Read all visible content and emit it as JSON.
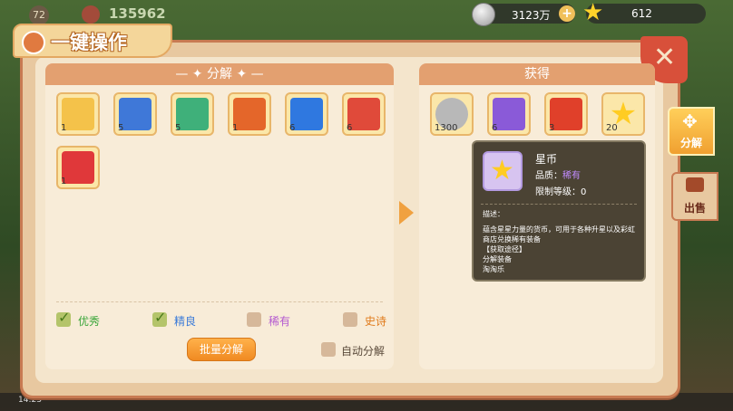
{
  "hud": {
    "level": "72",
    "score": "135962",
    "coin_value": "3123万",
    "coin_plus": "+",
    "star_value": "612",
    "clock": "14:23"
  },
  "panel": {
    "title": "一键操作",
    "close_symbol": "✕"
  },
  "decompose": {
    "header": "— ✦  分解  ✦ —",
    "items": [
      {
        "count": "1",
        "color": "#f4c24a",
        "icon": "ring"
      },
      {
        "count": "5",
        "color": "#3f78d8",
        "icon": "gear"
      },
      {
        "count": "5",
        "color": "#3fb07a",
        "icon": "frame"
      },
      {
        "count": "1",
        "color": "#e4662a",
        "icon": "frame"
      },
      {
        "count": "6",
        "color": "#2f78e0",
        "icon": "frame"
      },
      {
        "count": "6",
        "color": "#e04a3a",
        "icon": "frame"
      },
      {
        "count": "1",
        "color": "#e0383a",
        "icon": "blade"
      }
    ],
    "filters": [
      {
        "label": "优秀",
        "checked": true,
        "color": "#3aa63a"
      },
      {
        "label": "精良",
        "checked": true,
        "color": "#3a7ad8"
      },
      {
        "label": "稀有",
        "checked": false,
        "color": "#b45ad0"
      },
      {
        "label": "史诗",
        "checked": false,
        "color": "#e07a1a"
      }
    ],
    "batch_button": "批量分解",
    "auto_label": "自动分解"
  },
  "obtain": {
    "header": "获得",
    "items": [
      {
        "count": "1300",
        "icon": "silver-coin",
        "color": "#b8b8b8"
      },
      {
        "count": "6",
        "icon": "purple-crystal",
        "color": "#8a5ad8"
      },
      {
        "count": "3",
        "icon": "red-gem",
        "color": "#e0402a"
      },
      {
        "count": "20",
        "icon": "star",
        "color": "#ffcc22"
      }
    ]
  },
  "tooltip": {
    "name": "星币",
    "quality_label": "品质：",
    "quality_value": "稀有",
    "limit": "限制等级：0",
    "desc_title": "描述：",
    "desc": "蕴含星星力量的货币，可用于各种升星以及彩虹商店兑换稀有装备",
    "source_title": "【获取途径】",
    "source_1": "分解装备",
    "source_2": "淘淘乐"
  },
  "side_tabs": [
    {
      "label": "分解",
      "icon": "puzzle-icon"
    },
    {
      "label": "出售",
      "icon": "shop-icon"
    }
  ]
}
